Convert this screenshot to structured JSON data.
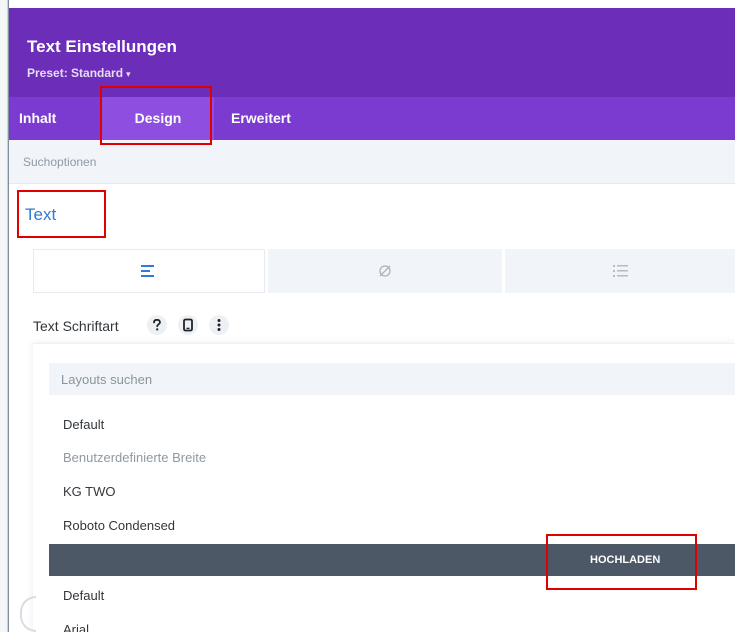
{
  "header": {
    "title": "Text Einstellungen",
    "preset_label": "Preset: Standard",
    "preset_caret": "▾"
  },
  "tabs": [
    {
      "label": "Inhalt",
      "active": false
    },
    {
      "label": "Design",
      "active": true
    },
    {
      "label": "Erweitert",
      "active": false
    }
  ],
  "search": {
    "placeholder": "Suchoptionen"
  },
  "section": {
    "title": "Text"
  },
  "text_tabs": {
    "icons": [
      "align-left-icon",
      "no-style-icon",
      "list-icon"
    ],
    "active_index": 0
  },
  "font_field": {
    "label": "Text Schriftart",
    "icons": [
      "help-icon",
      "mobile-icon",
      "more-options-icon"
    ]
  },
  "dropdown": {
    "search_placeholder": "Layouts suchen",
    "options": [
      "Default",
      "KG TWO",
      "Roboto Condensed"
    ],
    "group_label": "Benutzerdefinierte Breite",
    "upload_label": "HOCHLADEN",
    "options_after": [
      "Default",
      "Arial"
    ]
  },
  "colors": {
    "header_bg": "#6c2eb9",
    "tabs_bg": "#7b3bd0",
    "active_tab_bg": "#8e4fe0",
    "section_title": "#2d7bd4",
    "upload_button_bg": "#4c5866",
    "highlight_border": "#e00000"
  }
}
